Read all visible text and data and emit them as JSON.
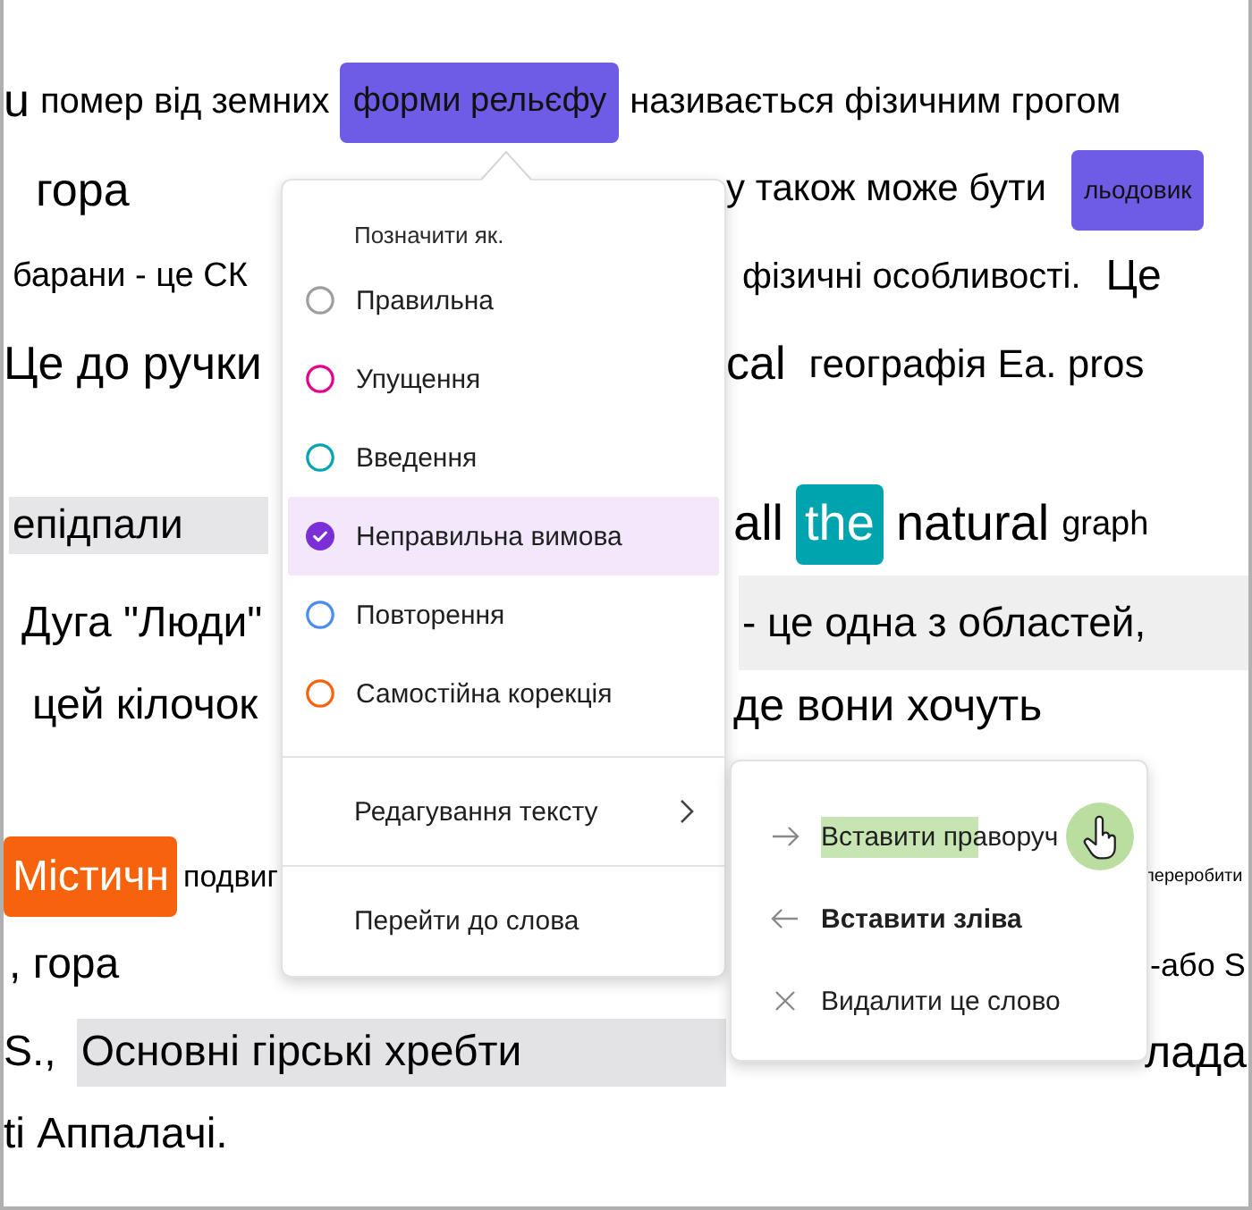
{
  "document": {
    "lines": [
      {
        "left": [
          {
            "text": "u",
            "kind": "plain"
          },
          {
            "text": "помер від земних",
            "kind": "plain"
          },
          {
            "text": "форми рельєфу",
            "kind": "highlight",
            "color": "#6e5ce6"
          },
          {
            "text": "називається фізичним грогом",
            "kind": "plain"
          }
        ]
      },
      {
        "left": [
          {
            "text": "гора",
            "kind": "plain"
          }
        ],
        "right": [
          {
            "text": "у також може бути",
            "kind": "plain"
          },
          {
            "text": "льодовик",
            "kind": "highlight",
            "color": "#6e5ce6"
          }
        ]
      },
      {
        "left": [
          {
            "text": "барани - це СК",
            "kind": "plain"
          }
        ],
        "right": [
          {
            "text": "фізичні особливості.",
            "kind": "plain"
          },
          {
            "text": "Це",
            "kind": "plain"
          }
        ]
      },
      {
        "left": [
          {
            "text": "Це до ручки",
            "kind": "plain"
          }
        ],
        "right": [
          {
            "text": "cal",
            "kind": "plain"
          },
          {
            "text": "географія Ea. pros",
            "kind": "plain"
          }
        ]
      },
      {
        "left": [
          {
            "text": "епідпали",
            "kind": "band"
          }
        ],
        "right": [
          {
            "text": "all",
            "kind": "plain"
          },
          {
            "text": "the",
            "kind": "chip",
            "color": "#00a4ae"
          },
          {
            "text": "natural",
            "kind": "plain"
          },
          {
            "text": "graph",
            "kind": "plain"
          }
        ]
      },
      {
        "left": [
          {
            "text": "Дуга \"Люди\"",
            "kind": "plain"
          }
        ],
        "right": [
          {
            "text": "- це одна з областей,",
            "kind": "band"
          }
        ]
      },
      {
        "left": [
          {
            "text": "цей кілочок",
            "kind": "plain"
          }
        ],
        "right": [
          {
            "text": "де вони хочуть",
            "kind": "plain"
          }
        ]
      },
      {
        "left": [
          {
            "text": "Містичн",
            "kind": "chip",
            "color": "#f7630c"
          },
          {
            "text": "подвиг",
            "kind": "plain"
          }
        ],
        "right": [
          {
            "text": "переробити",
            "kind": "plain"
          }
        ]
      },
      {
        "left": [
          {
            "text": ", гора",
            "kind": "plain"
          }
        ],
        "right": [
          {
            "text": "-або S",
            "kind": "plain"
          }
        ]
      },
      {
        "left": [
          {
            "text": "S.,",
            "kind": "plain"
          },
          {
            "text": "Основні гірські хребти",
            "kind": "band"
          }
        ],
        "right": [
          {
            "text": "лада",
            "kind": "plain"
          }
        ]
      },
      {
        "left": [
          {
            "text": "ti Аппалачі.",
            "kind": "plain"
          }
        ]
      }
    ]
  },
  "mark_menu": {
    "heading": "Позначити як.",
    "options": [
      {
        "label": "Правильна",
        "color": "#9e9e9e",
        "selected": false
      },
      {
        "label": "Упущення",
        "color": "#e3008c",
        "selected": false
      },
      {
        "label": "Введення",
        "color": "#00a4ae",
        "selected": false
      },
      {
        "label": "Неправильна вимова",
        "color": "#7a30d6",
        "selected": true
      },
      {
        "label": "Повторення",
        "color": "#4a8cf0",
        "selected": false
      },
      {
        "label": "Самостійна корекція",
        "color": "#f7630c",
        "selected": false
      }
    ],
    "actions": [
      {
        "label": "Редагування тексту",
        "submenu": true
      },
      {
        "label": "Перейти до слова",
        "submenu": false
      }
    ]
  },
  "edit_submenu": {
    "items": [
      {
        "label": "Вставити праворуч",
        "kind": "right",
        "hovered": true,
        "focused": false
      },
      {
        "label": "Вставити зліва",
        "kind": "left",
        "hovered": false,
        "focused": true
      },
      {
        "label": "Видалити це слово",
        "kind": "delete",
        "hovered": false,
        "focused": false
      }
    ]
  }
}
